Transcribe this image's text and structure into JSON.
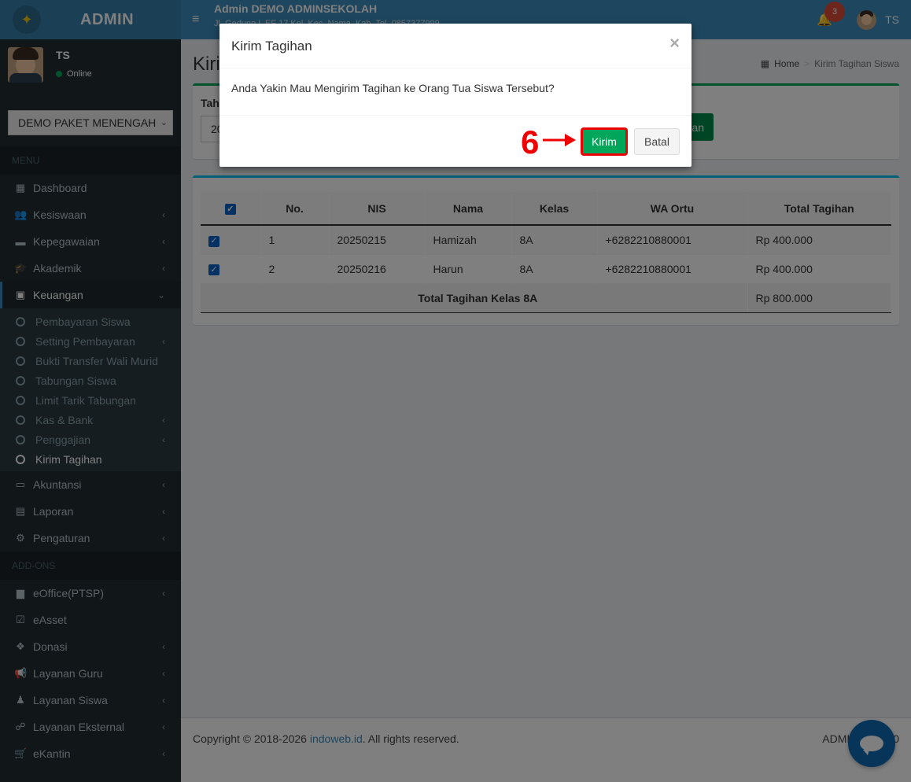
{
  "brand": {
    "logo_text": "ADMIN"
  },
  "user": {
    "name": "TS",
    "status": "Online"
  },
  "school_select": {
    "value": "DEMO PAKET MENENGAH"
  },
  "menu": {
    "header_main": "MENU",
    "items": [
      {
        "label": "Dashboard",
        "icon": "dashboard-icon",
        "glyph": "▦"
      },
      {
        "label": "Kesiswaan",
        "icon": "users-icon",
        "glyph": "👥"
      },
      {
        "label": "Kepegawaian",
        "icon": "briefcase-icon",
        "glyph": "▬"
      },
      {
        "label": "Akademik",
        "icon": "graduation-cap-icon",
        "glyph": "🎓"
      },
      {
        "label": "Keuangan",
        "icon": "money-icon",
        "glyph": "▣"
      }
    ],
    "submenu": [
      "Pembayaran Siswa",
      "Setting Pembayaran",
      "Bukti Transfer Wali Murid",
      "Tabungan Siswa",
      "Limit Tarik Tabungan",
      "Kas & Bank",
      "Penggajian",
      "Kirim Tagihan"
    ],
    "items_after": [
      {
        "label": "Akuntansi",
        "icon": "credit-card-icon",
        "glyph": "▭"
      },
      {
        "label": "Laporan",
        "icon": "file-icon",
        "glyph": "▤"
      },
      {
        "label": "Pengaturan",
        "icon": "gear-icon",
        "glyph": "⚙"
      }
    ],
    "header_addons": "ADD-ONS",
    "addons": [
      {
        "label": "eOffice(PTSP)",
        "icon": "archive-icon",
        "glyph": "▆"
      },
      {
        "label": "eAsset",
        "icon": "check-square-icon",
        "glyph": "☑"
      },
      {
        "label": "Donasi",
        "icon": "dropbox-icon",
        "glyph": "❖"
      },
      {
        "label": "Layanan Guru",
        "icon": "bullhorn-icon",
        "glyph": "📢"
      },
      {
        "label": "Layanan Siswa",
        "icon": "child-icon",
        "glyph": "♟"
      },
      {
        "label": "Layanan Eksternal",
        "icon": "handshake-icon",
        "glyph": "☍"
      },
      {
        "label": "eKantin",
        "icon": "cart-icon",
        "glyph": "🛒"
      }
    ]
  },
  "header": {
    "title": "Admin DEMO ADMINSEKOLAH",
    "subtitle": "Jl. Gedung L EF 17 Kel. Kec. Nama. Kab. Tel. 0857377999",
    "notification_count": "3",
    "user_initials": "TS"
  },
  "page": {
    "title": "Kiri",
    "breadcrumb_home": "Home",
    "breadcrumb_current": "Kirim Tagihan Siswa",
    "filter_label": "Tah",
    "filter_value": "20",
    "filter_button": "an"
  },
  "table": {
    "headers": [
      "No.",
      "NIS",
      "Nama",
      "Kelas",
      "WA Ortu",
      "Total Tagihan"
    ],
    "rows": [
      {
        "no": "1",
        "nis": "20250215",
        "nama": "Hamizah",
        "kelas": "8A",
        "wa": "+6282210880001",
        "total": "Rp 400.000"
      },
      {
        "no": "2",
        "nis": "20250216",
        "nama": "Harun",
        "kelas": "8A",
        "wa": "+6282210880001",
        "total": "Rp 400.000"
      }
    ],
    "total_label": "Total Tagihan Kelas 8A",
    "total_value": "Rp 800.000"
  },
  "footer": {
    "copyright": "Copyright © 2018-2026 ",
    "link": "indoweb.id",
    "rights": ". All rights reserved.",
    "right_text": "ADMIN SEKO",
    "right_tail": "0"
  },
  "modal": {
    "title": "Kirim Tagihan",
    "close": "×",
    "body": "Anda Yakin Mau Mengirim Tagihan ke Orang Tua Siswa Tersebut?",
    "confirm": "Kirim",
    "cancel": "Batal"
  },
  "annotation": {
    "step": "6"
  },
  "colors": {
    "sidebar": "#222d32",
    "header": "#3c8dbc",
    "success": "#00a65a",
    "highlight": "#ee0000"
  }
}
